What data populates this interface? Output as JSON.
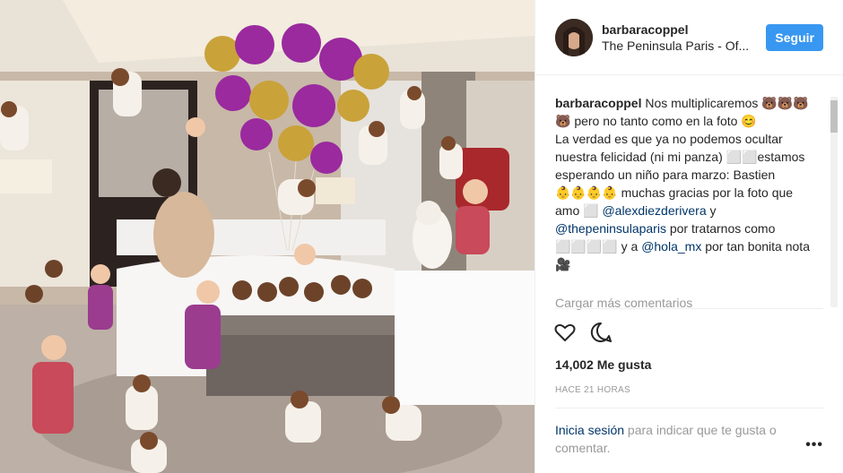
{
  "post": {
    "username": "barbaracoppel",
    "location": "The Peninsula Paris - Of...",
    "follow_label": "Seguir",
    "caption_user": "barbaracoppel",
    "caption_line1": "Nos multiplicaremos 🐻🐻🐻",
    "caption_line2": "🐻 pero no tanto como en la foto 😊",
    "caption_line3": "La verdad es que ya no podemos ocultar",
    "caption_line4": "nuestra felicidad (ni mi panza) ⬜⬜estamos",
    "caption_line5": "esperando un niño para marzo: Bastien",
    "caption_line6a": "👶👶👶👶 muchas gracias por la foto que",
    "caption_line7a": "amo ⬜ ",
    "mention1": "@alexdiezderivera",
    "caption_line7b": " y",
    "mention2": "@thepeninsulaparis",
    "caption_line8a": " por tratarnos como",
    "caption_line9a": "⬜⬜⬜⬜ y a ",
    "mention3": "@hola_mx",
    "caption_line9b": " por tan bonita nota",
    "caption_line10": "🎥",
    "load_more": "Cargar más comentarios",
    "likes": "14,002 Me gusta",
    "time": "HACE 21 HORAS",
    "login_link": "Inicia sesión",
    "login_rest": " para indicar que te gusta o comentar.",
    "more_icon": "•••"
  },
  "icons": {
    "like": "heart-icon",
    "comment": "comment-icon",
    "options": "more-options-icon"
  },
  "colors": {
    "follow": "#3897f0",
    "mention": "#003569",
    "muted": "#999999",
    "balloon_gold": "#c9a23a",
    "balloon_purple": "#9a2a9e"
  }
}
